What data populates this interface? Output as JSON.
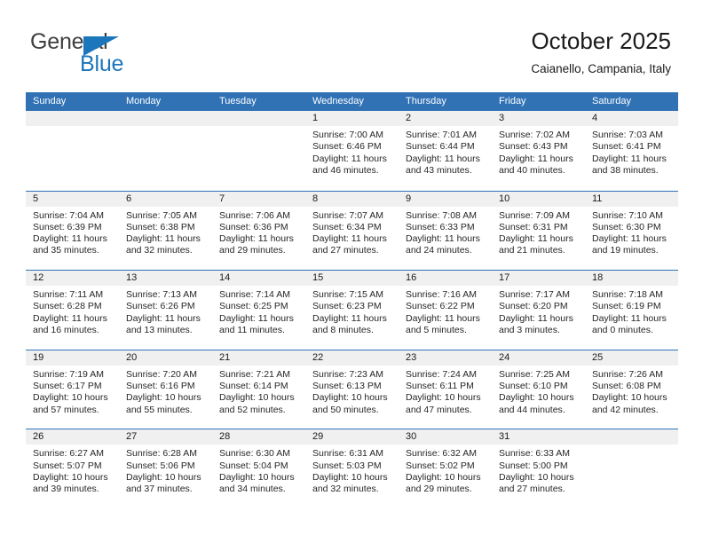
{
  "brand": {
    "name_part1": "General",
    "name_part2": "Blue",
    "accent_color": "#1b76bc"
  },
  "header": {
    "title": "October 2025",
    "subtitle": "Caianello, Campania, Italy",
    "header_bg_color": "#3172b5",
    "date_strip_color": "#f0f0f0"
  },
  "weekdays": [
    "Sunday",
    "Monday",
    "Tuesday",
    "Wednesday",
    "Thursday",
    "Friday",
    "Saturday"
  ],
  "weeks": [
    [
      {
        "day": "",
        "sunrise": "",
        "sunset": "",
        "daylight_line1": "",
        "daylight_line2": ""
      },
      {
        "day": "",
        "sunrise": "",
        "sunset": "",
        "daylight_line1": "",
        "daylight_line2": ""
      },
      {
        "day": "",
        "sunrise": "",
        "sunset": "",
        "daylight_line1": "",
        "daylight_line2": ""
      },
      {
        "day": "1",
        "sunrise": "Sunrise: 7:00 AM",
        "sunset": "Sunset: 6:46 PM",
        "daylight_line1": "Daylight: 11 hours",
        "daylight_line2": "and 46 minutes."
      },
      {
        "day": "2",
        "sunrise": "Sunrise: 7:01 AM",
        "sunset": "Sunset: 6:44 PM",
        "daylight_line1": "Daylight: 11 hours",
        "daylight_line2": "and 43 minutes."
      },
      {
        "day": "3",
        "sunrise": "Sunrise: 7:02 AM",
        "sunset": "Sunset: 6:43 PM",
        "daylight_line1": "Daylight: 11 hours",
        "daylight_line2": "and 40 minutes."
      },
      {
        "day": "4",
        "sunrise": "Sunrise: 7:03 AM",
        "sunset": "Sunset: 6:41 PM",
        "daylight_line1": "Daylight: 11 hours",
        "daylight_line2": "and 38 minutes."
      }
    ],
    [
      {
        "day": "5",
        "sunrise": "Sunrise: 7:04 AM",
        "sunset": "Sunset: 6:39 PM",
        "daylight_line1": "Daylight: 11 hours",
        "daylight_line2": "and 35 minutes."
      },
      {
        "day": "6",
        "sunrise": "Sunrise: 7:05 AM",
        "sunset": "Sunset: 6:38 PM",
        "daylight_line1": "Daylight: 11 hours",
        "daylight_line2": "and 32 minutes."
      },
      {
        "day": "7",
        "sunrise": "Sunrise: 7:06 AM",
        "sunset": "Sunset: 6:36 PM",
        "daylight_line1": "Daylight: 11 hours",
        "daylight_line2": "and 29 minutes."
      },
      {
        "day": "8",
        "sunrise": "Sunrise: 7:07 AM",
        "sunset": "Sunset: 6:34 PM",
        "daylight_line1": "Daylight: 11 hours",
        "daylight_line2": "and 27 minutes."
      },
      {
        "day": "9",
        "sunrise": "Sunrise: 7:08 AM",
        "sunset": "Sunset: 6:33 PM",
        "daylight_line1": "Daylight: 11 hours",
        "daylight_line2": "and 24 minutes."
      },
      {
        "day": "10",
        "sunrise": "Sunrise: 7:09 AM",
        "sunset": "Sunset: 6:31 PM",
        "daylight_line1": "Daylight: 11 hours",
        "daylight_line2": "and 21 minutes."
      },
      {
        "day": "11",
        "sunrise": "Sunrise: 7:10 AM",
        "sunset": "Sunset: 6:30 PM",
        "daylight_line1": "Daylight: 11 hours",
        "daylight_line2": "and 19 minutes."
      }
    ],
    [
      {
        "day": "12",
        "sunrise": "Sunrise: 7:11 AM",
        "sunset": "Sunset: 6:28 PM",
        "daylight_line1": "Daylight: 11 hours",
        "daylight_line2": "and 16 minutes."
      },
      {
        "day": "13",
        "sunrise": "Sunrise: 7:13 AM",
        "sunset": "Sunset: 6:26 PM",
        "daylight_line1": "Daylight: 11 hours",
        "daylight_line2": "and 13 minutes."
      },
      {
        "day": "14",
        "sunrise": "Sunrise: 7:14 AM",
        "sunset": "Sunset: 6:25 PM",
        "daylight_line1": "Daylight: 11 hours",
        "daylight_line2": "and 11 minutes."
      },
      {
        "day": "15",
        "sunrise": "Sunrise: 7:15 AM",
        "sunset": "Sunset: 6:23 PM",
        "daylight_line1": "Daylight: 11 hours",
        "daylight_line2": "and 8 minutes."
      },
      {
        "day": "16",
        "sunrise": "Sunrise: 7:16 AM",
        "sunset": "Sunset: 6:22 PM",
        "daylight_line1": "Daylight: 11 hours",
        "daylight_line2": "and 5 minutes."
      },
      {
        "day": "17",
        "sunrise": "Sunrise: 7:17 AM",
        "sunset": "Sunset: 6:20 PM",
        "daylight_line1": "Daylight: 11 hours",
        "daylight_line2": "and 3 minutes."
      },
      {
        "day": "18",
        "sunrise": "Sunrise: 7:18 AM",
        "sunset": "Sunset: 6:19 PM",
        "daylight_line1": "Daylight: 11 hours",
        "daylight_line2": "and 0 minutes."
      }
    ],
    [
      {
        "day": "19",
        "sunrise": "Sunrise: 7:19 AM",
        "sunset": "Sunset: 6:17 PM",
        "daylight_line1": "Daylight: 10 hours",
        "daylight_line2": "and 57 minutes."
      },
      {
        "day": "20",
        "sunrise": "Sunrise: 7:20 AM",
        "sunset": "Sunset: 6:16 PM",
        "daylight_line1": "Daylight: 10 hours",
        "daylight_line2": "and 55 minutes."
      },
      {
        "day": "21",
        "sunrise": "Sunrise: 7:21 AM",
        "sunset": "Sunset: 6:14 PM",
        "daylight_line1": "Daylight: 10 hours",
        "daylight_line2": "and 52 minutes."
      },
      {
        "day": "22",
        "sunrise": "Sunrise: 7:23 AM",
        "sunset": "Sunset: 6:13 PM",
        "daylight_line1": "Daylight: 10 hours",
        "daylight_line2": "and 50 minutes."
      },
      {
        "day": "23",
        "sunrise": "Sunrise: 7:24 AM",
        "sunset": "Sunset: 6:11 PM",
        "daylight_line1": "Daylight: 10 hours",
        "daylight_line2": "and 47 minutes."
      },
      {
        "day": "24",
        "sunrise": "Sunrise: 7:25 AM",
        "sunset": "Sunset: 6:10 PM",
        "daylight_line1": "Daylight: 10 hours",
        "daylight_line2": "and 44 minutes."
      },
      {
        "day": "25",
        "sunrise": "Sunrise: 7:26 AM",
        "sunset": "Sunset: 6:08 PM",
        "daylight_line1": "Daylight: 10 hours",
        "daylight_line2": "and 42 minutes."
      }
    ],
    [
      {
        "day": "26",
        "sunrise": "Sunrise: 6:27 AM",
        "sunset": "Sunset: 5:07 PM",
        "daylight_line1": "Daylight: 10 hours",
        "daylight_line2": "and 39 minutes."
      },
      {
        "day": "27",
        "sunrise": "Sunrise: 6:28 AM",
        "sunset": "Sunset: 5:06 PM",
        "daylight_line1": "Daylight: 10 hours",
        "daylight_line2": "and 37 minutes."
      },
      {
        "day": "28",
        "sunrise": "Sunrise: 6:30 AM",
        "sunset": "Sunset: 5:04 PM",
        "daylight_line1": "Daylight: 10 hours",
        "daylight_line2": "and 34 minutes."
      },
      {
        "day": "29",
        "sunrise": "Sunrise: 6:31 AM",
        "sunset": "Sunset: 5:03 PM",
        "daylight_line1": "Daylight: 10 hours",
        "daylight_line2": "and 32 minutes."
      },
      {
        "day": "30",
        "sunrise": "Sunrise: 6:32 AM",
        "sunset": "Sunset: 5:02 PM",
        "daylight_line1": "Daylight: 10 hours",
        "daylight_line2": "and 29 minutes."
      },
      {
        "day": "31",
        "sunrise": "Sunrise: 6:33 AM",
        "sunset": "Sunset: 5:00 PM",
        "daylight_line1": "Daylight: 10 hours",
        "daylight_line2": "and 27 minutes."
      },
      {
        "day": "",
        "sunrise": "",
        "sunset": "",
        "daylight_line1": "",
        "daylight_line2": ""
      }
    ]
  ]
}
